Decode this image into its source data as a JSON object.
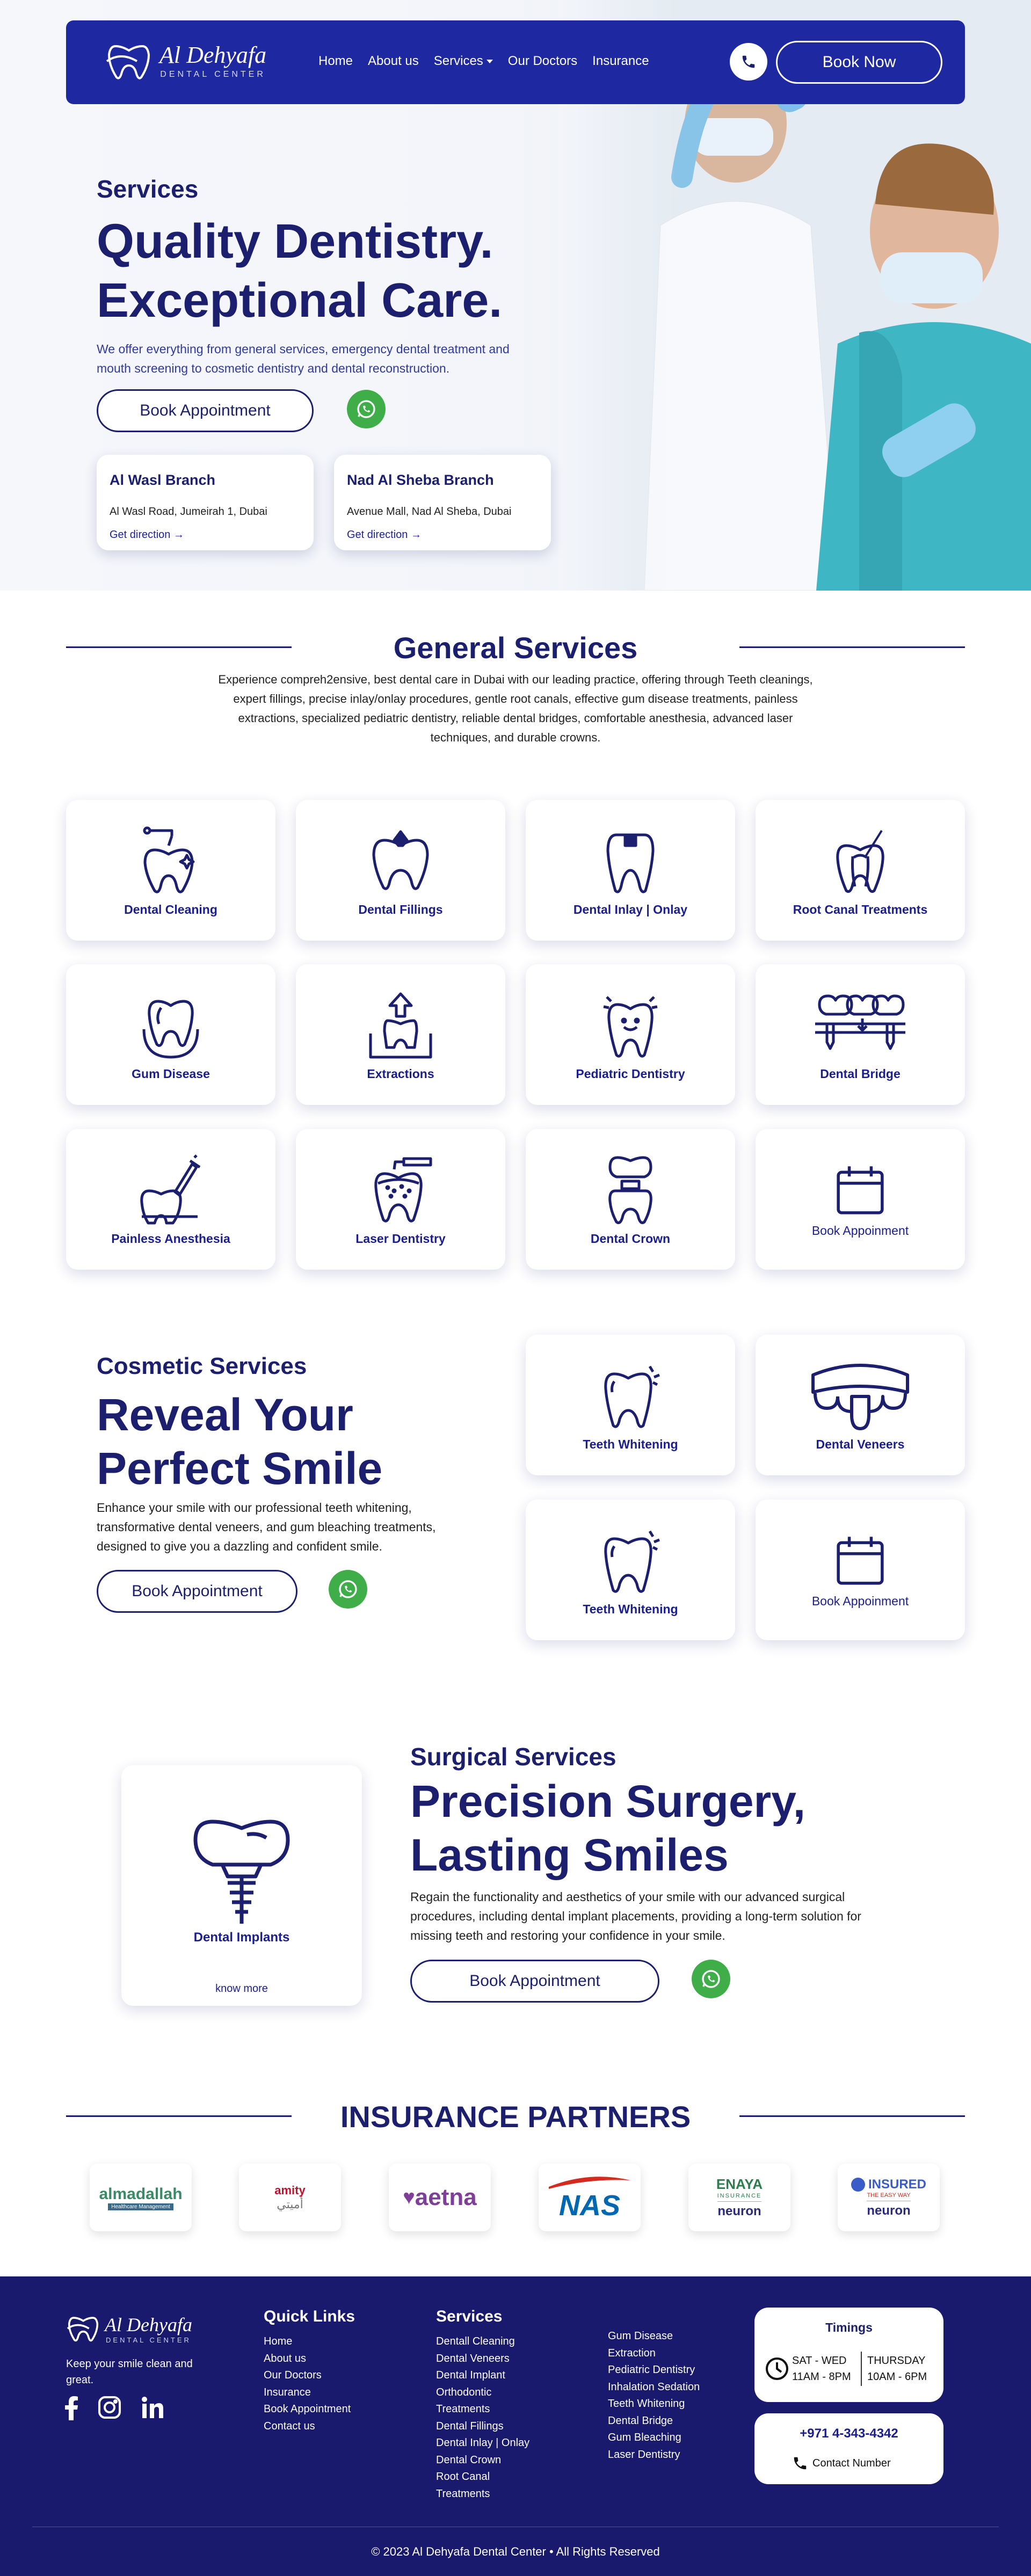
{
  "brand": {
    "name": "Al Dehyafa",
    "subtitle": "DENTAL CENTER"
  },
  "nav": {
    "links": [
      "Home",
      "About us",
      "Services",
      "Our Doctors",
      "Insurance"
    ],
    "book_now": "Book Now"
  },
  "hero": {
    "eyebrow": "Services",
    "title_line1": "Quality Dentistry.",
    "title_line2": "Exceptional Care.",
    "description": "We offer everything from general services, emergency dental treatment and mouth screening to cosmetic dentistry and dental reconstruction.",
    "cta": "Book Appointment",
    "branches": [
      {
        "title": "Al Wasl Branch",
        "address": "Al Wasl Road, Jumeirah 1, Dubai",
        "link": "Get direction →"
      },
      {
        "title": "Nad Al Sheba Branch",
        "address": "Avenue Mall, Nad Al Sheba, Dubai",
        "link": "Get direction →"
      }
    ]
  },
  "general": {
    "heading": "General Services",
    "intro": "Experience compreh2ensive, best dental care in Dubai with our leading practice, offering through Teeth cleanings, expert fillings, precise inlay/onlay procedures, gentle root canals, effective gum disease treatments, painless extractions, specialized pediatric dentistry, reliable dental bridges, comfortable anesthesia, advanced laser techniques, and durable crowns.",
    "cards": [
      {
        "label": "Dental Cleaning",
        "icon": "tooth-cleaning-icon"
      },
      {
        "label": "Dental Fillings",
        "icon": "tooth-filling-icon"
      },
      {
        "label": "Dental Inlay | Onlay",
        "icon": "tooth-inlay-icon"
      },
      {
        "label": "Root Canal Treatments",
        "icon": "root-canal-icon"
      },
      {
        "label": "Gum Disease",
        "icon": "gum-disease-icon"
      },
      {
        "label": "Extractions",
        "icon": "extraction-icon"
      },
      {
        "label": "Pediatric Dentistry",
        "icon": "happy-tooth-icon"
      },
      {
        "label": "Dental Bridge",
        "icon": "dental-bridge-icon"
      },
      {
        "label": "Painless Anesthesia",
        "icon": "syringe-tooth-icon"
      },
      {
        "label": "Laser Dentistry",
        "icon": "laser-tooth-icon"
      },
      {
        "label": "Dental Crown",
        "icon": "dental-crown-icon"
      },
      {
        "label": "Book Appoinment",
        "icon": "calendar-icon"
      }
    ]
  },
  "cosmetic": {
    "eyebrow": "Cosmetic Services",
    "title_line1": "Reveal Your",
    "title_line2": "Perfect Smile",
    "description": "Enhance your smile with our professional teeth whitening, transformative dental veneers, and gum bleaching treatments, designed to give you a dazzling and confident smile.",
    "cta": "Book Appointment",
    "cards": [
      {
        "label": "Teeth Whitening",
        "icon": "sparkle-tooth-icon"
      },
      {
        "label": "Dental Veneers",
        "icon": "veneers-icon"
      },
      {
        "label": "Teeth Whitening",
        "icon": "sparkle-tooth-icon"
      },
      {
        "label": "Book Appoinment",
        "icon": "calendar-icon"
      }
    ]
  },
  "surgical": {
    "eyebrow": "Surgical Services",
    "title_line1": "Precision Surgery,",
    "title_line2": "Lasting Smiles",
    "description": "Regain the functionality and aesthetics of your smile with our advanced surgical procedures, including dental implant placements, providing a long-term solution for missing teeth and restoring your confidence in your smile.",
    "cta": "Book Appointment",
    "card_label": "Dental Implants",
    "card_link": "know more"
  },
  "insurance": {
    "heading": "INSURANCE PARTNERS",
    "partners": [
      {
        "name": "almadallah",
        "sub": "Healthcare Management"
      },
      {
        "name": "amity",
        "sub": "أميتي"
      },
      {
        "name": "aetna",
        "sub": ""
      },
      {
        "name": "NAS",
        "sub": ""
      },
      {
        "name": "ENAYA",
        "sub": "INSURANCE",
        "extra": "neuron"
      },
      {
        "name": "INSURED",
        "sub": "THE EASY WAY",
        "extra": "neuron"
      }
    ]
  },
  "footer": {
    "tagline": "Keep your smile clean and great.",
    "quick_links_title": "Quick Links",
    "quick_links": [
      "Home",
      "About us",
      "Our Doctors",
      "Insurance",
      "Book Appointment",
      "Contact us"
    ],
    "services_title": "Services",
    "services_col1": [
      "Dentall Cleaning",
      "Dental Veneers",
      "Dental Implant",
      "Orthodontic",
      "Treatments",
      "Dental Fillings",
      "Dental Inlay | Onlay",
      "Dental Crown",
      "Root Canal",
      "Treatments"
    ],
    "services_col2": [
      "Gum Disease",
      "Extraction",
      "Pediatric Dentistry",
      "Inhalation Sedation",
      "Teeth Whitening",
      "Dental Bridge",
      "Gum Bleaching",
      "Laser Dentistry"
    ],
    "timings_title": "Timings",
    "timing_left_days": "SAT - WED",
    "timing_left_hours": "11AM - 8PM",
    "timing_right_days": "THURSDAY",
    "timing_right_hours": "10AM - 6PM",
    "phone": "+971 4-343-4342",
    "phone_label": "Contact Number",
    "copyright": "© 2023 Al Dehyafa Dental Center • All Rights Reserved"
  },
  "colors": {
    "primary": "#1e28a0",
    "navy": "#1b1f6e",
    "footer": "#19196d",
    "whatsapp": "#3fae49"
  }
}
